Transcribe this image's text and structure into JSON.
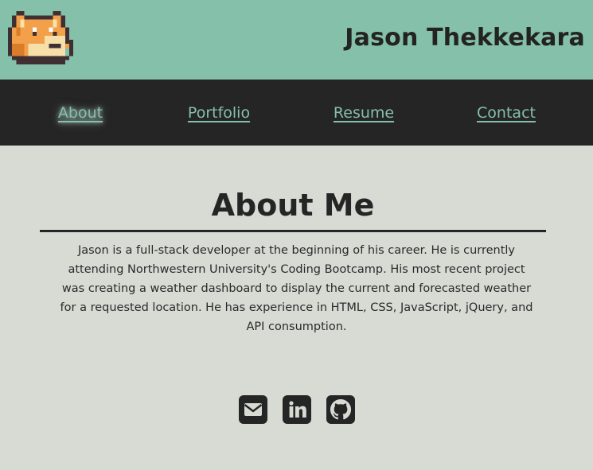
{
  "header": {
    "title": "Jason Thekkekara",
    "logo_icon": "pixel-fox-logo-icon"
  },
  "nav": {
    "items": [
      {
        "label": "About",
        "active": true
      },
      {
        "label": "Portfolio",
        "active": false
      },
      {
        "label": "Resume",
        "active": false
      },
      {
        "label": "Contact",
        "active": false
      }
    ]
  },
  "about": {
    "heading": "About Me",
    "bio": "Jason is a full-stack developer at the beginning of his career. He is currently attending Northwestern University's Coding Bootcamp. His most recent project was creating a weather dashboard to display the current and forecasted weather for a requested location. He has experience in HTML, CSS, JavaScript, jQuery, and API consumption."
  },
  "socials": [
    {
      "icon": "email-icon"
    },
    {
      "icon": "linkedin-icon"
    },
    {
      "icon": "github-icon"
    }
  ],
  "colors": {
    "accent": "#84c0aa",
    "dark": "#252525",
    "background": "#d8dad4"
  }
}
